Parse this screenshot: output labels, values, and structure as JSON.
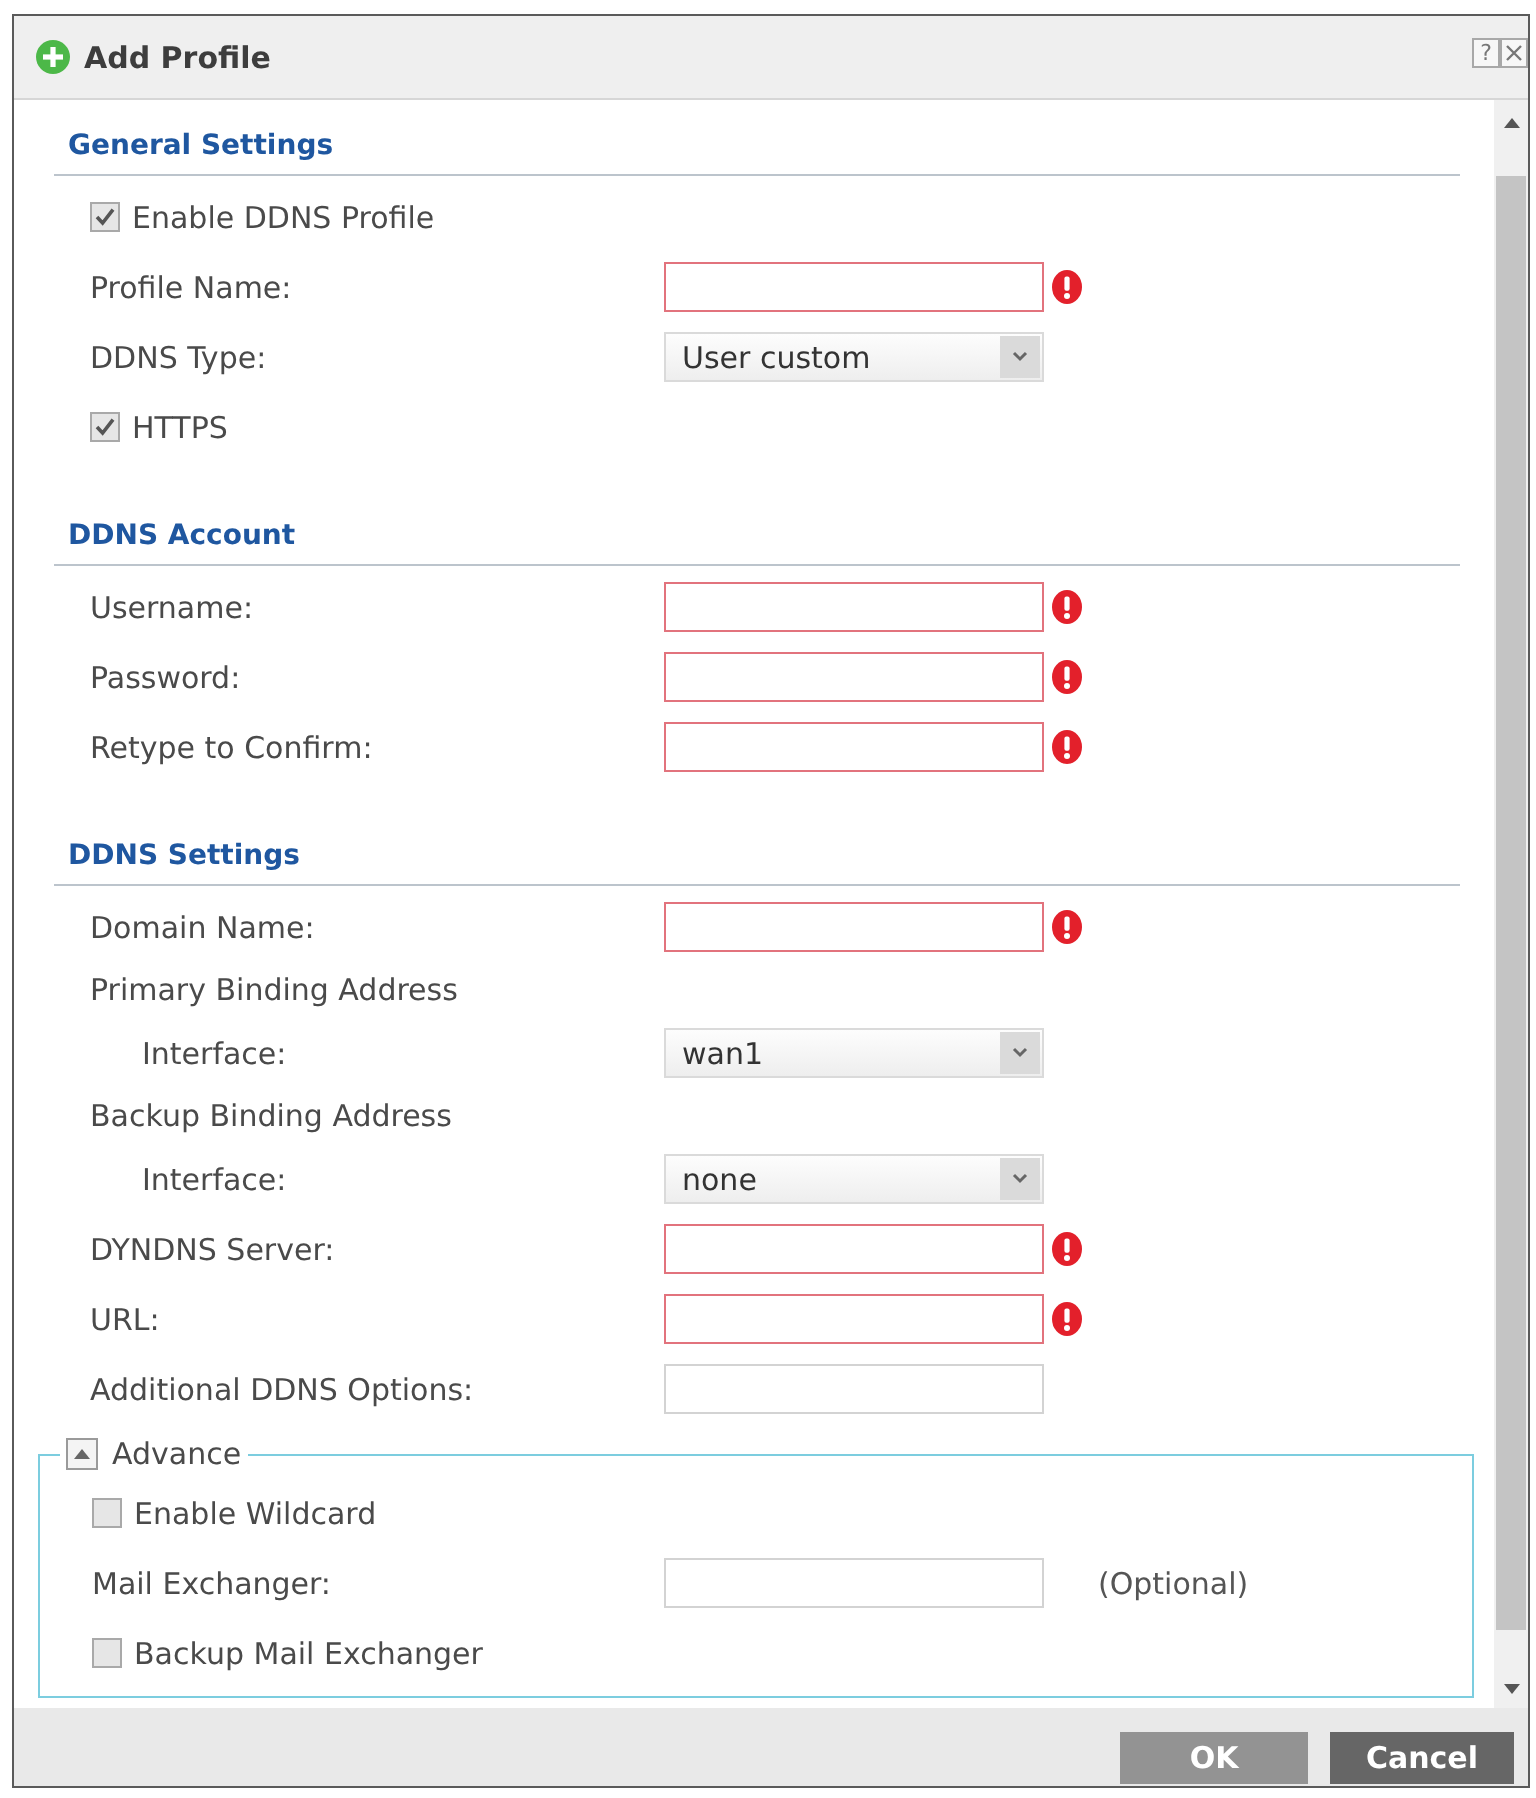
{
  "dialog": {
    "title": "Add Profile",
    "help": "?"
  },
  "sections": [
    {
      "title": "General Settings",
      "rows": [
        {
          "kind": "checkbox",
          "label": "Enable DDNS Profile",
          "checked": true
        },
        {
          "kind": "input",
          "label": "Profile Name:",
          "required": true
        },
        {
          "kind": "select",
          "label": "DDNS Type:",
          "value": "User custom"
        },
        {
          "kind": "checkbox",
          "label": "HTTPS",
          "checked": true
        }
      ]
    },
    {
      "title": "DDNS Account",
      "rows": [
        {
          "kind": "input",
          "label": "Username:",
          "required": true
        },
        {
          "kind": "input",
          "label": "Password:",
          "required": true
        },
        {
          "kind": "input",
          "label": "Retype to Confirm:",
          "required": true
        }
      ]
    },
    {
      "title": "DDNS Settings",
      "rows": [
        {
          "kind": "input",
          "label": "Domain Name:",
          "required": true
        },
        {
          "kind": "group",
          "label": "Primary Binding Address",
          "children": [
            {
              "kind": "select",
              "label": "Interface:",
              "value": "wan1"
            }
          ]
        },
        {
          "kind": "group",
          "label": "Backup Binding Address",
          "children": [
            {
              "kind": "select",
              "label": "Interface:",
              "value": "none"
            }
          ]
        },
        {
          "kind": "input",
          "label": "DYNDNS Server:",
          "required": true
        },
        {
          "kind": "input",
          "label": "URL:",
          "required": true
        },
        {
          "kind": "input",
          "label": "Additional DDNS Options:",
          "required": false
        }
      ]
    }
  ],
  "advance": {
    "legend": "Advance",
    "expanded": true,
    "rows": [
      {
        "kind": "checkbox",
        "label": "Enable Wildcard",
        "checked": false
      },
      {
        "kind": "input",
        "label": "Mail Exchanger:",
        "required": false,
        "note": "(Optional)"
      },
      {
        "kind": "checkbox",
        "label": "Backup Mail Exchanger",
        "checked": false
      }
    ]
  },
  "buttons": [
    {
      "label": "OK",
      "disabled": true
    },
    {
      "label": "Cancel",
      "disabled": false
    }
  ]
}
